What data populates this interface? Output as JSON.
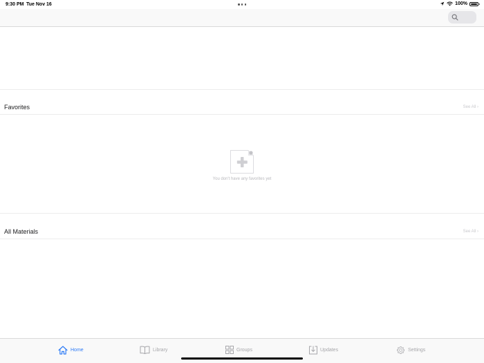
{
  "status_bar": {
    "time": "9:30 PM",
    "date": "Tue Nov 16",
    "battery": "100%"
  },
  "nav_bar": {
    "search_icon": "magnifier-icon"
  },
  "sections": {
    "favorites": {
      "title": "Favorites",
      "see_all": "See All ›",
      "empty_text": "You don't have any favorites yet",
      "empty_icon": "document-plus-icon"
    },
    "all_materials": {
      "title": "All Materials",
      "see_all": "See All ›"
    }
  },
  "tab_bar": {
    "tabs": [
      {
        "label": "Home",
        "icon": "house-icon",
        "active": true
      },
      {
        "label": "Library",
        "icon": "open-book-icon",
        "active": false
      },
      {
        "label": "Groups",
        "icon": "grid-icon",
        "active": false
      },
      {
        "label": "Updates",
        "icon": "download-tray-icon",
        "active": false
      },
      {
        "label": "Settings",
        "icon": "gear-icon",
        "active": false
      }
    ]
  },
  "colors": {
    "accent": "#2f7cf6",
    "inactive": "#a6a6aa",
    "bar_background": "#f9f9f9"
  }
}
